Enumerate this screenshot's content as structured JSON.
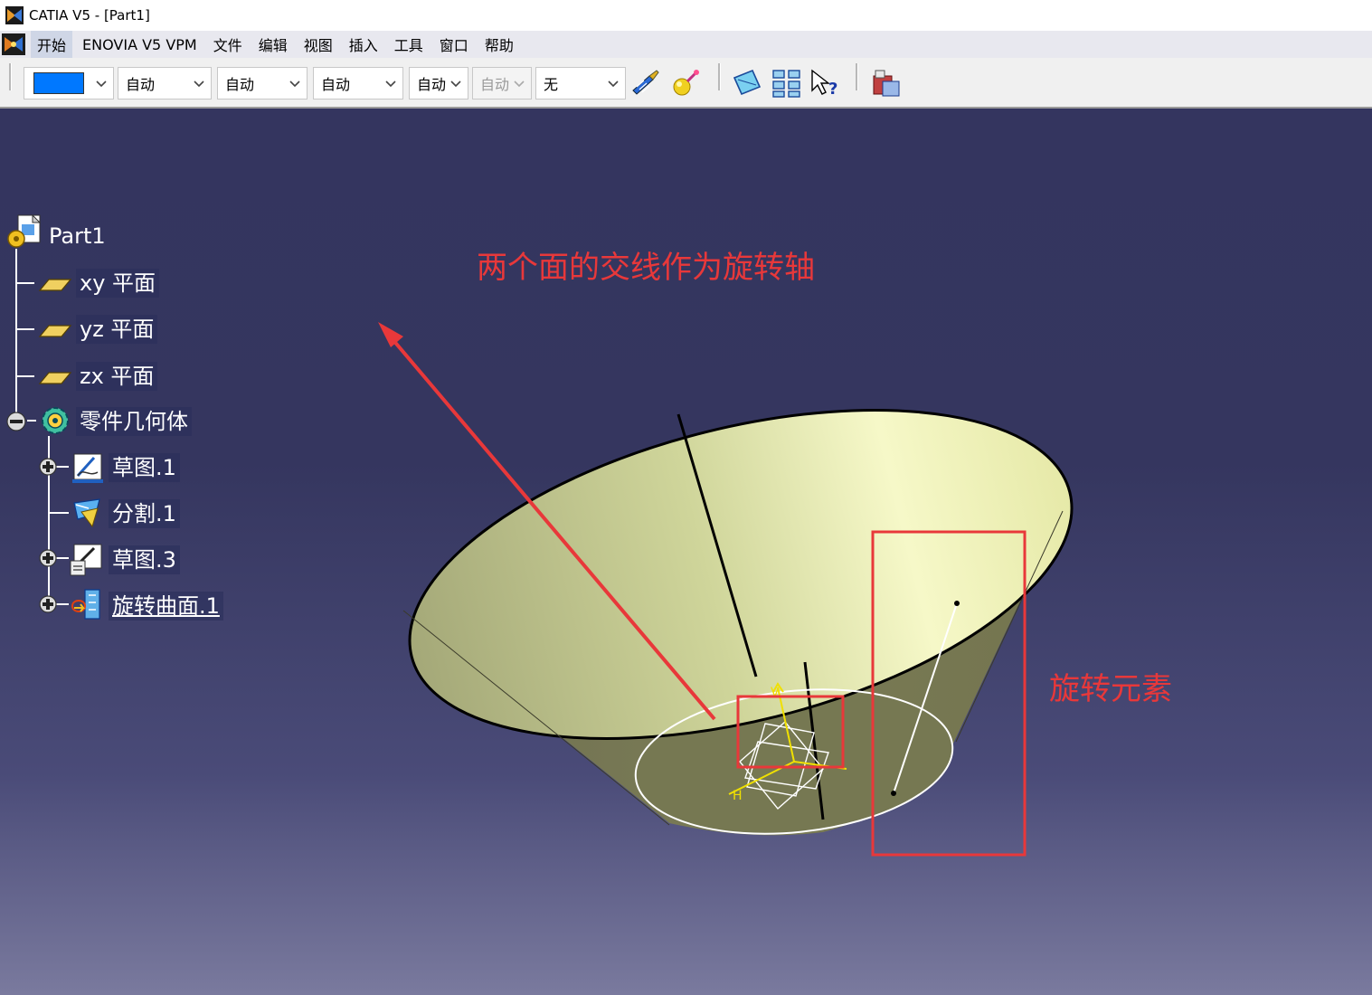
{
  "window": {
    "title": "CATIA V5 - [Part1]"
  },
  "menu": {
    "items": [
      {
        "label": "开始",
        "active": true
      },
      {
        "label": "ENOVIA V5 VPM"
      },
      {
        "label": "文件"
      },
      {
        "label": "编辑"
      },
      {
        "label": "视图"
      },
      {
        "label": "插入"
      },
      {
        "label": "工具"
      },
      {
        "label": "窗口"
      },
      {
        "label": "帮助"
      }
    ]
  },
  "toolbar": {
    "color_value": "#0078ff",
    "dropdowns": [
      {
        "value": "自动"
      },
      {
        "value": "自动"
      },
      {
        "value": "自动"
      },
      {
        "value": "自动"
      },
      {
        "value": "自动",
        "disabled": true
      },
      {
        "value": "无"
      }
    ],
    "icons": [
      "painter-brush-icon",
      "sphere-wand-icon",
      "plane-select-icon",
      "grid-icon",
      "help-pointer-icon",
      "catalog-box-icon"
    ]
  },
  "tree": {
    "root": "Part1",
    "planes": [
      "xy 平面",
      "yz 平面",
      "zx 平面"
    ],
    "body": "零件几何体",
    "children": [
      "草图.1",
      "分割.1",
      "草图.3",
      "旋转曲面.1"
    ]
  },
  "annotations": {
    "axis_label": "两个面的交线作为旋转轴",
    "element_label": "旋转元素"
  },
  "colors": {
    "annotation": "#e8383a",
    "viewport_top": "#34355f",
    "viewport_bottom": "#7a7a9e",
    "surface": "#dfe3a8"
  }
}
